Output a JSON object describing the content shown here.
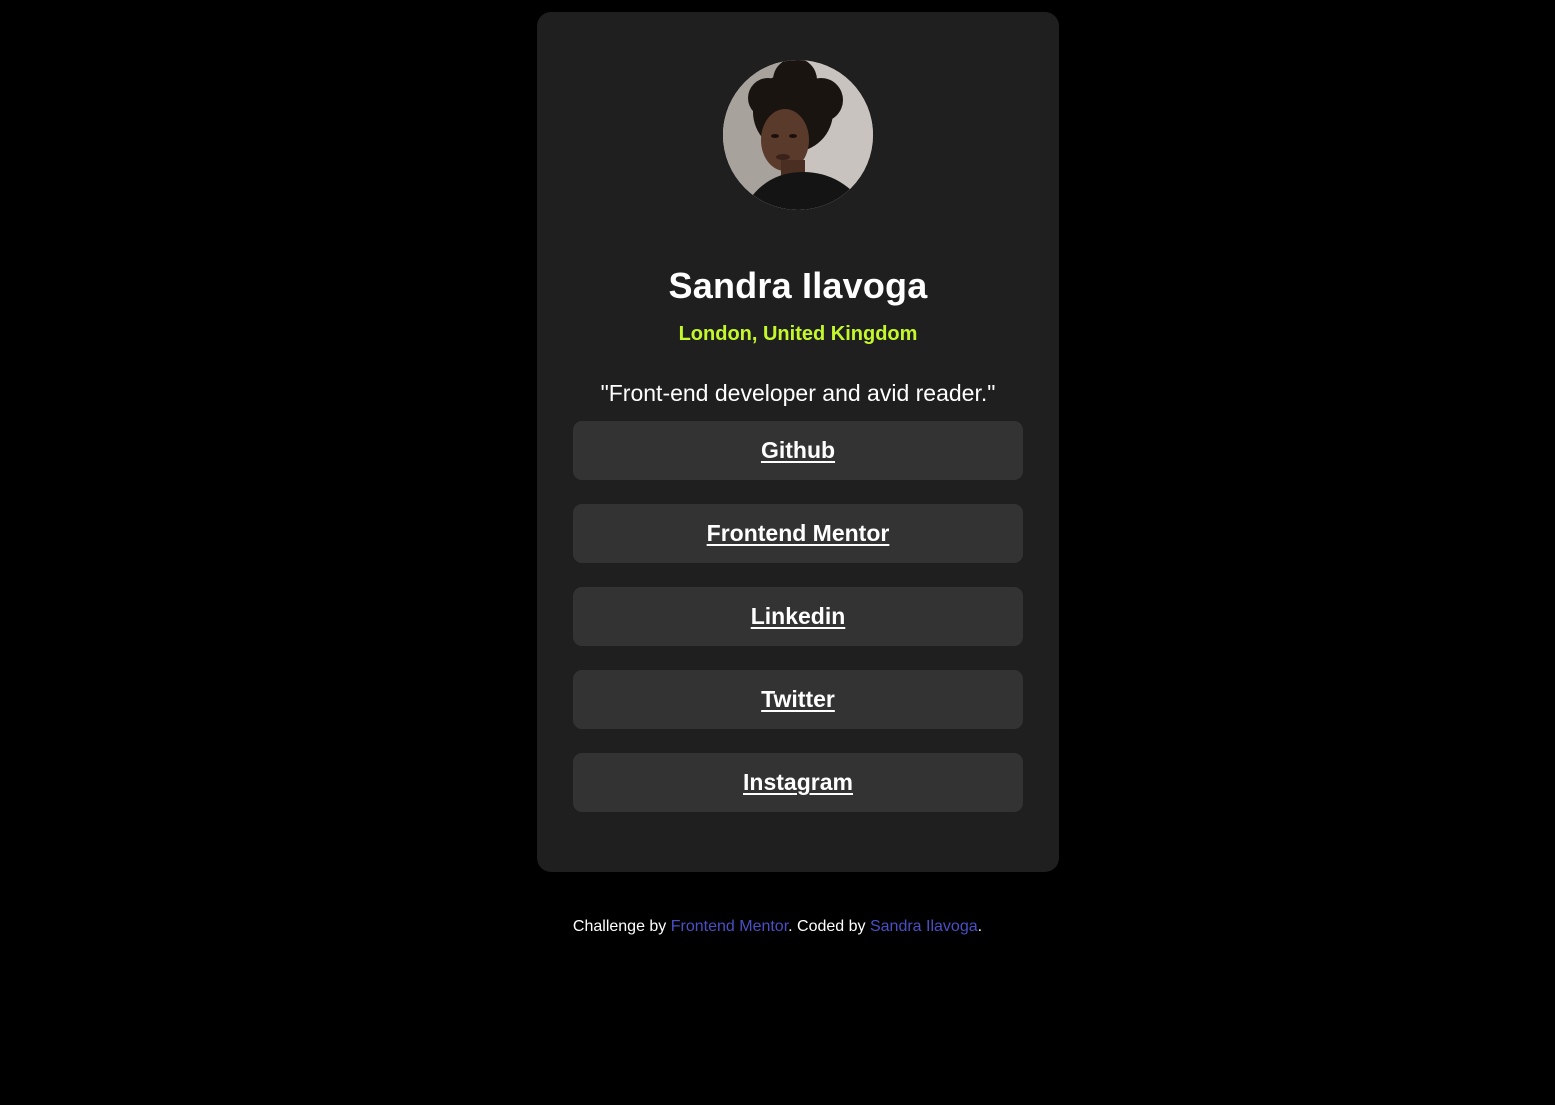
{
  "colors": {
    "page_background": "#000000",
    "card_background": "#1f1f1f",
    "button_background": "#333333",
    "accent": "#c4f82a",
    "footer_link": "#4a4fc4"
  },
  "profile": {
    "avatar_alt": "profile photo",
    "name": "Sandra Ilavoga",
    "location": "London, United Kingdom",
    "bio": "\"Front-end developer and avid reader.\""
  },
  "links": [
    {
      "label": "Github"
    },
    {
      "label": "Frontend Mentor"
    },
    {
      "label": "Linkedin"
    },
    {
      "label": "Twitter"
    },
    {
      "label": "Instagram"
    }
  ],
  "footer": {
    "prefix": "Challenge by ",
    "challenge_link": "Frontend Mentor",
    "middle": ". Coded by ",
    "author_link": "Sandra Ilavoga",
    "suffix": "."
  }
}
